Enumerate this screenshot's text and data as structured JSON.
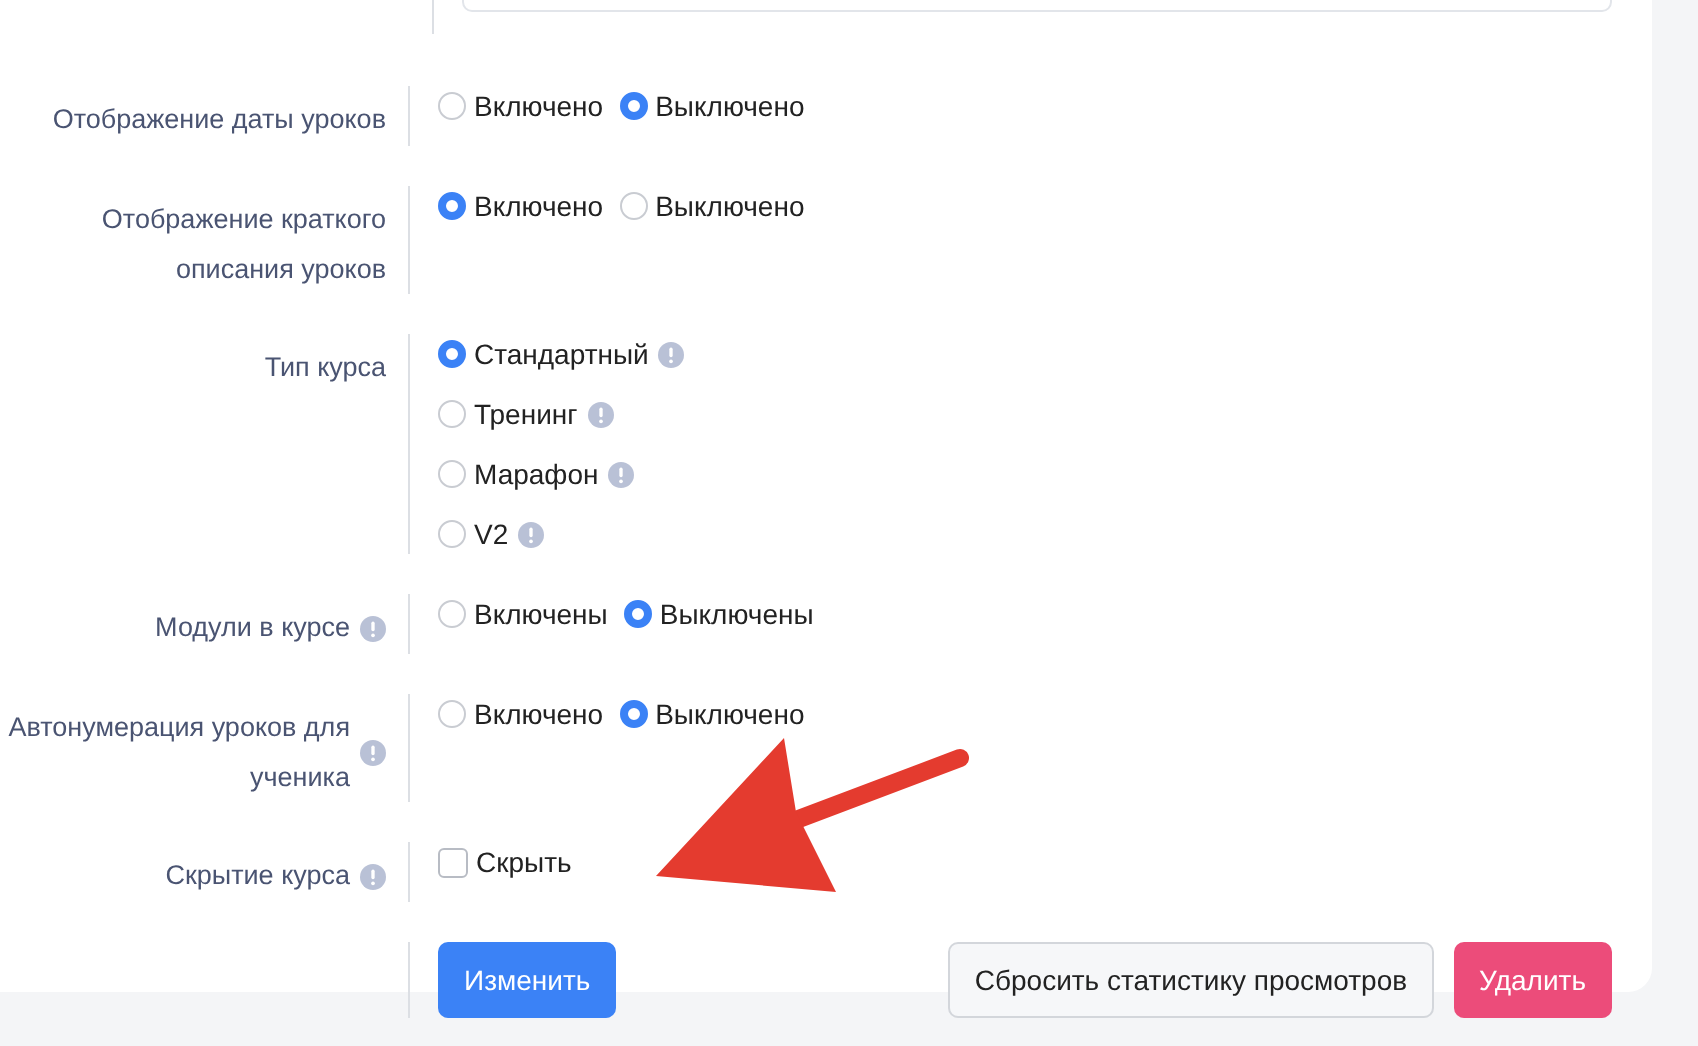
{
  "partial_field": {
    "kind": "input"
  },
  "settings": [
    {
      "label": "Отображение даты уроков",
      "info": false,
      "kind": "radio",
      "inline": true,
      "options": [
        {
          "label": "Включено",
          "selected": false,
          "info": false
        },
        {
          "label": "Выключено",
          "selected": true,
          "info": false
        }
      ]
    },
    {
      "label": "Отображение краткого описания уроков",
      "info": false,
      "kind": "radio",
      "inline": true,
      "options": [
        {
          "label": "Включено",
          "selected": true,
          "info": false
        },
        {
          "label": "Выключено",
          "selected": false,
          "info": false
        }
      ]
    },
    {
      "label": "Тип курса",
      "info": false,
      "kind": "radio",
      "inline": false,
      "options": [
        {
          "label": "Стандартный",
          "selected": true,
          "info": true
        },
        {
          "label": "Тренинг",
          "selected": false,
          "info": true
        },
        {
          "label": "Марафон",
          "selected": false,
          "info": true
        },
        {
          "label": "V2",
          "selected": false,
          "info": true
        }
      ]
    },
    {
      "label": "Модули в курсе",
      "info": true,
      "kind": "radio",
      "inline": true,
      "options": [
        {
          "label": "Включены",
          "selected": false,
          "info": false
        },
        {
          "label": "Выключены",
          "selected": true,
          "info": false
        }
      ]
    },
    {
      "label": "Автонумерация уроков для ученика",
      "info": true,
      "kind": "radio",
      "inline": true,
      "options": [
        {
          "label": "Включено",
          "selected": false,
          "info": false
        },
        {
          "label": "Выключено",
          "selected": true,
          "info": false
        }
      ]
    },
    {
      "label": "Скрытие курса",
      "info": true,
      "kind": "checkbox",
      "inline": true,
      "options": [
        {
          "label": "Скрыть",
          "selected": false,
          "info": false
        }
      ]
    }
  ],
  "actions": {
    "save": "Изменить",
    "reset": "Сбросить статистику просмотров",
    "delete": "Удалить"
  },
  "annotation": {
    "kind": "arrow"
  }
}
